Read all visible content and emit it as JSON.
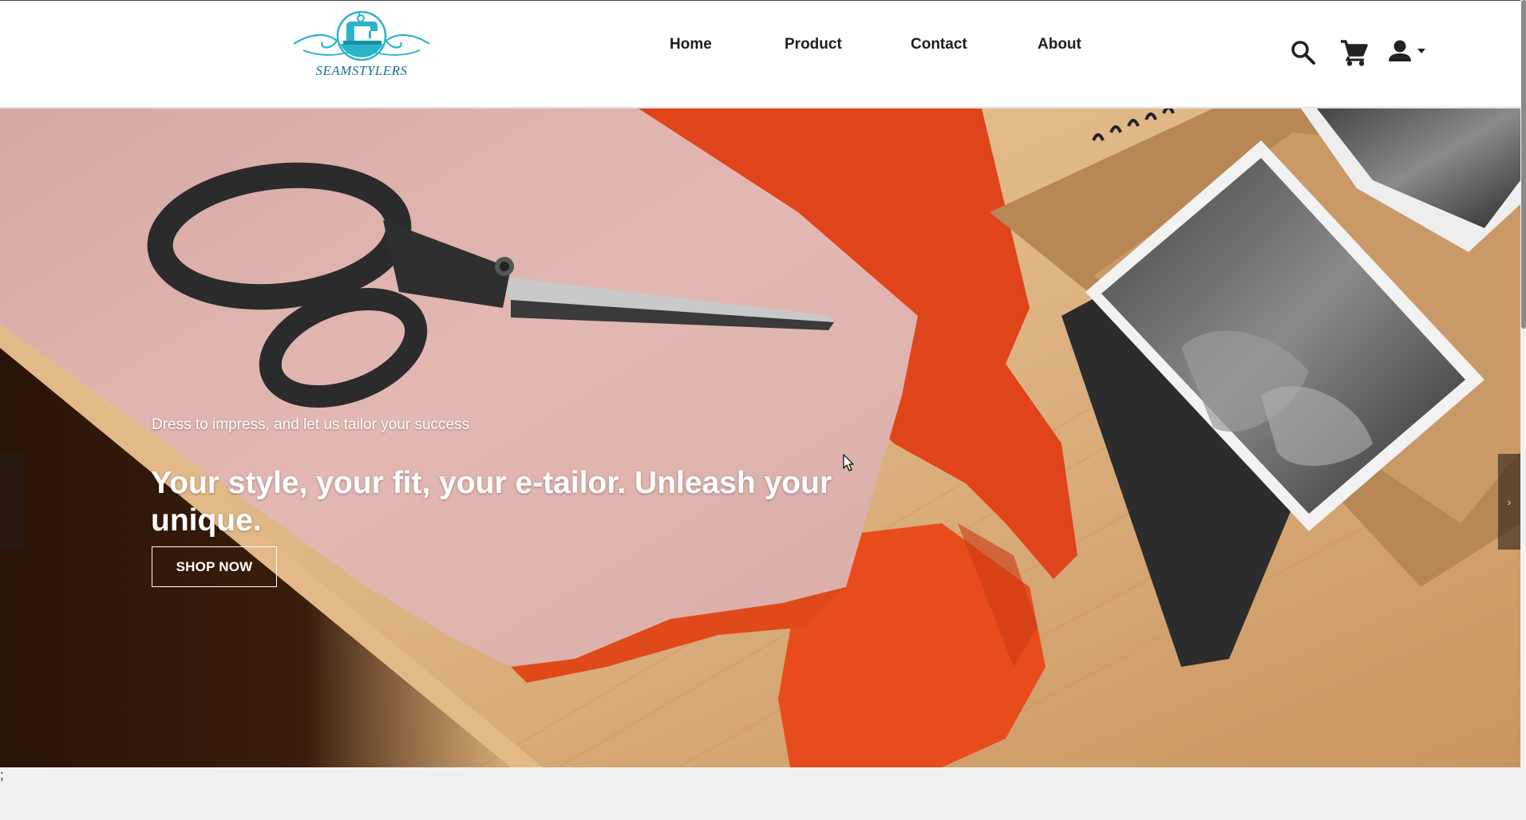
{
  "brand": {
    "name": "SEAMSTYLERS",
    "colors": {
      "logo_teal": "#2bb3c9",
      "logo_text": "#1c6f8c"
    }
  },
  "nav": {
    "links": [
      "Home",
      "Product",
      "Contact",
      "About"
    ]
  },
  "header_icons": {
    "search": "search-icon",
    "cart": "cart-icon",
    "account": "user-icon",
    "account_dropdown": "caret-down-icon"
  },
  "hero": {
    "subtitle": "Dress to impress, and let us tailor your success",
    "title": "Your style, your fit, your e-tailor. Unleash your unique.",
    "cta_label": "SHOP NOW",
    "next_arrow": "›"
  },
  "footer_text": ";"
}
